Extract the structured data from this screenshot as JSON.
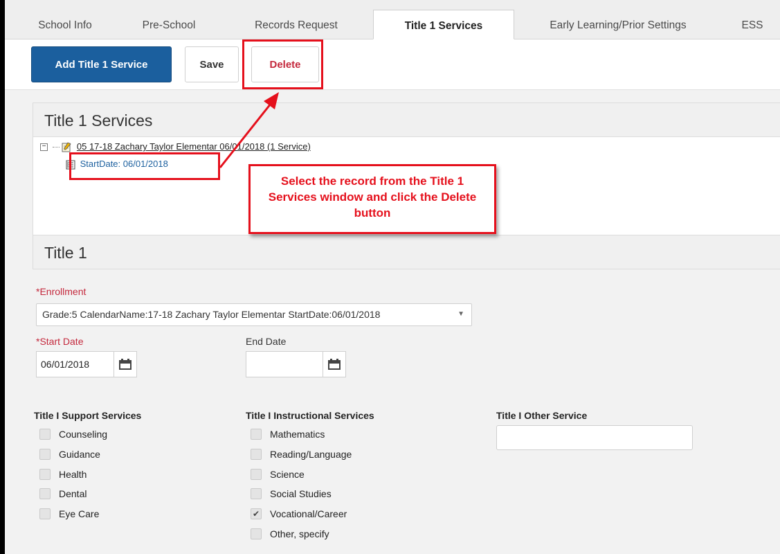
{
  "tabs": [
    {
      "label": "School Info"
    },
    {
      "label": "Pre-School"
    },
    {
      "label": "Records Request"
    },
    {
      "label": "Title 1 Services",
      "active": true
    },
    {
      "label": "Early Learning/Prior Settings"
    },
    {
      "label": "ESS"
    }
  ],
  "toolbar": {
    "add_label": "Add Title 1 Service",
    "save_label": "Save",
    "delete_label": "Delete"
  },
  "services_panel": {
    "title": "Title 1 Services",
    "tree_root": "05 17-18 Zachary Taylor Elementar 06/01/2018 (1 Service)",
    "tree_child": "StartDate: 06/01/2018"
  },
  "annotation": {
    "callout_text": "Select the record from the Title 1 Services window and click the Delete button",
    "color": "#e5101c"
  },
  "title1_panel": {
    "title": "Title 1"
  },
  "form": {
    "enrollment_label": "*Enrollment",
    "enrollment_value": "Grade:5 CalendarName:17-18 Zachary Taylor Elementar StartDate:06/01/2018",
    "start_date_label": "*Start Date",
    "start_date_value": "06/01/2018",
    "end_date_label": "End Date",
    "end_date_value": "",
    "support_heading": "Title I Support Services",
    "support_services": [
      {
        "label": "Counseling",
        "checked": false
      },
      {
        "label": "Guidance",
        "checked": false
      },
      {
        "label": "Health",
        "checked": false
      },
      {
        "label": "Dental",
        "checked": false
      },
      {
        "label": "Eye Care",
        "checked": false
      }
    ],
    "instructional_heading": "Title I Instructional Services",
    "instructional_services": [
      {
        "label": "Mathematics",
        "checked": false
      },
      {
        "label": "Reading/Language",
        "checked": false
      },
      {
        "label": "Science",
        "checked": false
      },
      {
        "label": "Social Studies",
        "checked": false
      },
      {
        "label": "Vocational/Career",
        "checked": true
      },
      {
        "label": "Other, specify",
        "checked": false
      }
    ],
    "other_heading": "Title I Other Service",
    "other_value": ""
  },
  "colors": {
    "primary": "#1b5f9e",
    "required": "#c4283c",
    "annotation_red": "#e5101c"
  }
}
